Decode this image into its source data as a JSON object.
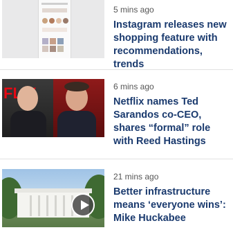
{
  "articles": [
    {
      "time": "5 mins ago",
      "title": "Instagram releases new shopping feature with recommendations, trends",
      "thumb": "instagram-app-screenshot"
    },
    {
      "time": "6 mins ago",
      "title": "Netflix names Ted Sarandos co-CEO, shares “formal” role with Reed Hastings",
      "thumb": "netflix-executives-photo",
      "logo_text": "FLIX"
    },
    {
      "time": "21 mins ago",
      "title": "Better infrastructure means ‘everyone wins’: Mike Huckabee",
      "thumb": "white-house-video",
      "icon": "play-icon"
    }
  ],
  "colors": {
    "headline": "#1a3a6e",
    "timestamp": "#555555",
    "divider": "#e1e1e1"
  }
}
